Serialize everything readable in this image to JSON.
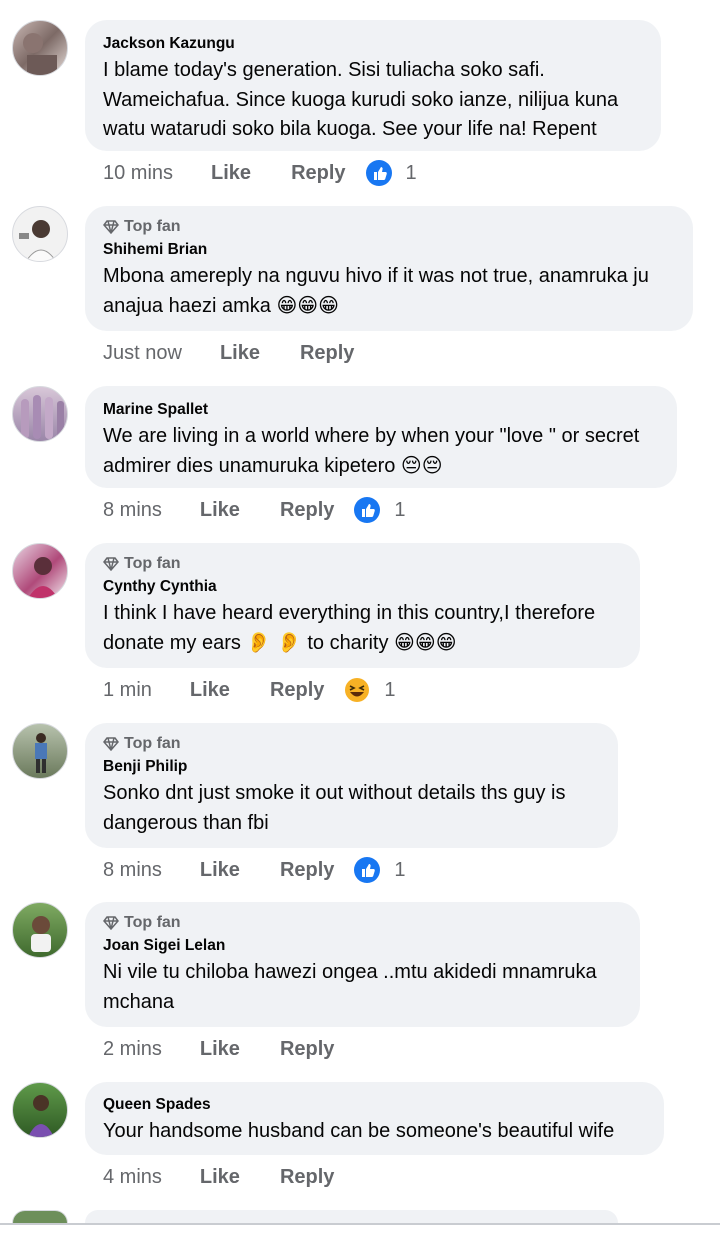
{
  "comments": [
    {
      "name": "Jackson Kazungu",
      "badge": "",
      "text": "I blame today's generation. Sisi tuliacha soko safi. Wameichafua. Since kuoga kurudi soko ianze, nilijua kuna watu watarudi soko bila kuoga. See your life na! Repent",
      "time": "10 mins",
      "like": "Like",
      "reply": "Reply",
      "reaction": "like",
      "count": "1"
    },
    {
      "name": "Shihemi Brian",
      "badge": "Top fan",
      "text": "Mbona amereply na nguvu hivo if it was not true, anamruka ju anajua haezi amka 😁😁😁",
      "time": "Just now",
      "like": "Like",
      "reply": "Reply",
      "reaction": "",
      "count": ""
    },
    {
      "name": "Marine Spallet",
      "badge": "",
      "text": "We are living in a world where by when your \"love \" or secret admirer dies unamuruka kipetero 😔😔",
      "time": "8 mins",
      "like": "Like",
      "reply": "Reply",
      "reaction": "like",
      "count": "1"
    },
    {
      "name": "Cynthy Cynthia",
      "badge": "Top fan",
      "text": "I think I have heard everything in this country,I therefore donate my ears 👂 👂 to charity 😁😁😁",
      "time": "1 min",
      "like": "Like",
      "reply": "Reply",
      "reaction": "haha",
      "count": "1"
    },
    {
      "name": "Benji Philip",
      "badge": "Top fan",
      "text": "Sonko dnt just smoke it out without details ths guy is dangerous than fbi",
      "time": "8 mins",
      "like": "Like",
      "reply": "Reply",
      "reaction": "like",
      "count": "1"
    },
    {
      "name": "Joan Sigei Lelan",
      "badge": "Top fan",
      "text": "Ni vile tu chiloba hawezi ongea ..mtu akidedi mnamruka mchana",
      "time": "2 mins",
      "like": "Like",
      "reply": "Reply",
      "reaction": "",
      "count": ""
    },
    {
      "name": "Queen Spades",
      "badge": "",
      "text": "Your handsome husband can be someone's beautiful wife",
      "time": "4 mins",
      "like": "Like",
      "reply": "Reply",
      "reaction": "",
      "count": ""
    }
  ],
  "colors": {
    "bubble": "#f0f2f5",
    "meta": "#65676b",
    "like_blue": "#1877f2",
    "haha_yellow": "#f7b125"
  }
}
